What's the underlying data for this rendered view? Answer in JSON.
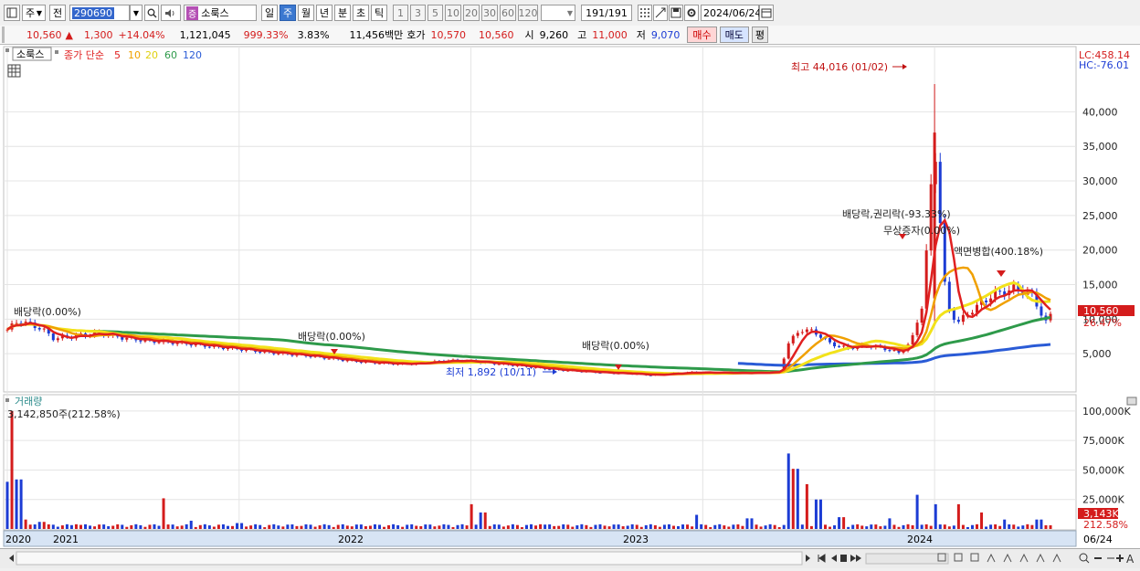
{
  "toolbar": {
    "type_label": "주",
    "jeon_label": "전",
    "stock_code": "290690",
    "stock_badge": "증",
    "stock_name": "소룩스",
    "period_tabs": [
      "일",
      "주",
      "월",
      "년",
      "분",
      "초",
      "틱"
    ],
    "active_period": "주",
    "interval_nums": [
      "1",
      "3",
      "5",
      "10",
      "20",
      "30",
      "60",
      "120"
    ],
    "count_value": "191",
    "count_total": "/191",
    "date_value": "2024/06/24"
  },
  "quote": {
    "price": "10,560",
    "direction": "▲",
    "change": "1,300",
    "change_pct": "+14.04%",
    "volume": "1,121,045",
    "volume_ratio": "999.33%",
    "turnover": "3.83%",
    "amount": "11,456백만",
    "ask_label": "호가",
    "ask": "10,570",
    "bid": "10,560",
    "open_label": "시",
    "open": "9,260",
    "high_label": "고",
    "high": "11,000",
    "low_label": "저",
    "low": "9,070",
    "buy_label": "매수",
    "sell_label": "매도",
    "eval_label": "평"
  },
  "chart": {
    "name_tag": "소룩스",
    "ma_label": "종가 단순",
    "ma_periods": [
      "5",
      "10",
      "20",
      "60",
      "120"
    ],
    "ma_colors": [
      "#e02020",
      "#f0a000",
      "#f2e21a",
      "#2e9a4a",
      "#2a5bd6"
    ],
    "lc": "LC:458.14",
    "hc": "HC:-76.01",
    "current_price_tag": "10,560",
    "current_pct_tag": "26.47%",
    "annotations": {
      "high": "최고 44,016 (01/02)",
      "low": "최저 1,892 (10/11)",
      "div_a": "배당락(0.00%)",
      "div_b": "배당락(0.00%)",
      "div_c": "배당락(0.00%)",
      "rights": "배당락,권리락(-93.33%)",
      "bonus": "무상증자(0.00%)",
      "merge": "액면병합(400.18%)"
    },
    "volume_title": "거래량",
    "volume_value": "3,142,850주(212.58%)",
    "volume_tag": "3,143K",
    "volume_pct_tag": "212.58%",
    "volume_axis": [
      "100,000K",
      "75,000K",
      "50,000K",
      "25,000K"
    ],
    "x_labels": [
      "2020",
      "2021",
      "2022",
      "2023",
      "2024",
      "06/24"
    ]
  },
  "chart_data": {
    "type": "candlestick",
    "y_ticks": [
      5000,
      10000,
      15000,
      20000,
      25000,
      30000,
      35000,
      40000
    ],
    "y_tick_labels": [
      "5,000",
      "10,000",
      "15,000",
      "20,000",
      "25,000",
      "30,000",
      "35,000",
      "40,000"
    ],
    "ylim": [
      0,
      46000
    ],
    "volume_ylim": [
      0,
      110000
    ],
    "close_series": [
      [
        2020.0,
        8500
      ],
      [
        2020.05,
        9800
      ],
      [
        2020.1,
        9200
      ],
      [
        2020.15,
        8600
      ],
      [
        2020.2,
        7200
      ],
      [
        2020.3,
        7600
      ],
      [
        2020.4,
        8000
      ],
      [
        2020.5,
        7300
      ],
      [
        2020.6,
        6900
      ],
      [
        2020.7,
        6700
      ],
      [
        2020.8,
        6400
      ],
      [
        2020.9,
        6000
      ],
      [
        2021.0,
        5700
      ],
      [
        2021.1,
        5300
      ],
      [
        2021.2,
        5000
      ],
      [
        2021.3,
        4700
      ],
      [
        2021.4,
        4300
      ],
      [
        2021.5,
        3900
      ],
      [
        2021.6,
        3700
      ],
      [
        2021.7,
        3500
      ],
      [
        2021.8,
        3700
      ],
      [
        2021.9,
        4000
      ],
      [
        2022.0,
        3900
      ],
      [
        2022.1,
        3600
      ],
      [
        2022.2,
        3300
      ],
      [
        2022.3,
        2900
      ],
      [
        2022.4,
        2600
      ],
      [
        2022.5,
        2400
      ],
      [
        2022.6,
        2200
      ],
      [
        2022.7,
        2100
      ],
      [
        2022.77,
        1892
      ],
      [
        2022.85,
        2100
      ],
      [
        2022.95,
        2300
      ],
      [
        2023.05,
        2250
      ],
      [
        2023.15,
        2200
      ],
      [
        2023.25,
        2250
      ],
      [
        2023.33,
        2400
      ],
      [
        2023.37,
        6500
      ],
      [
        2023.42,
        8500
      ],
      [
        2023.48,
        8200
      ],
      [
        2023.55,
        6500
      ],
      [
        2023.62,
        5800
      ],
      [
        2023.7,
        6200
      ],
      [
        2023.78,
        5800
      ],
      [
        2023.85,
        5100
      ],
      [
        2023.9,
        6800
      ],
      [
        2023.95,
        12500
      ],
      [
        2024.0,
        36000
      ],
      [
        2024.05,
        12000
      ],
      [
        2024.1,
        9500
      ],
      [
        2024.15,
        11000
      ],
      [
        2024.25,
        13500
      ],
      [
        2024.35,
        14500
      ],
      [
        2024.42,
        13500
      ],
      [
        2024.48,
        9500
      ],
      [
        2024.49,
        10560
      ]
    ],
    "volume_k": [
      [
        2020.0,
        40000
      ],
      [
        2020.02,
        100000
      ],
      [
        2020.05,
        42000
      ],
      [
        2020.08,
        8000
      ],
      [
        2020.15,
        6000
      ],
      [
        2020.3,
        4000
      ],
      [
        2020.5,
        3000
      ],
      [
        2020.68,
        26000
      ],
      [
        2020.8,
        7000
      ],
      [
        2021.0,
        5000
      ],
      [
        2021.3,
        3000
      ],
      [
        2022.0,
        21000
      ],
      [
        2022.05,
        14000
      ],
      [
        2022.3,
        4000
      ],
      [
        2022.6,
        3000
      ],
      [
        2022.97,
        12000
      ],
      [
        2023.2,
        9000
      ],
      [
        2023.37,
        64000
      ],
      [
        2023.4,
        51000
      ],
      [
        2023.45,
        38000
      ],
      [
        2023.5,
        25000
      ],
      [
        2023.6,
        10000
      ],
      [
        2023.8,
        9000
      ],
      [
        2023.92,
        29000
      ],
      [
        2024.0,
        21000
      ],
      [
        2024.1,
        21000
      ],
      [
        2024.2,
        14000
      ],
      [
        2024.3,
        8000
      ],
      [
        2024.45,
        8000
      ],
      [
        2024.49,
        3143
      ]
    ]
  }
}
